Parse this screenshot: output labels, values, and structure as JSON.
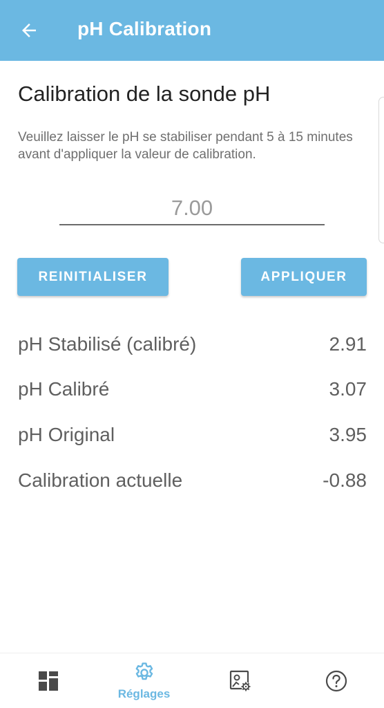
{
  "header": {
    "title": "pH Calibration",
    "back_icon": "arrow-left-icon",
    "background_color": "#6bb8e2"
  },
  "main": {
    "heading": "Calibration de la sonde pH",
    "description": "Veuillez laisser le pH se stabiliser pendant 5 à 15 minutes avant d'appliquer la valeur de calibration.",
    "ph_input": {
      "placeholder": "7.00",
      "value": ""
    },
    "buttons": {
      "reset_label": "REINITIALISER",
      "apply_label": "APPLIQUER"
    },
    "readings": [
      {
        "label": "pH Stabilisé (calibré)",
        "value": "2.91"
      },
      {
        "label": "pH Calibré",
        "value": "3.07"
      },
      {
        "label": "pH Original",
        "value": "3.95"
      },
      {
        "label": "Calibration actuelle",
        "value": "-0.88"
      }
    ]
  },
  "bottom_nav": {
    "items": [
      {
        "icon": "dashboard-icon",
        "label": "",
        "active": false
      },
      {
        "icon": "gear-icon",
        "label": "Réglages",
        "active": true
      },
      {
        "icon": "image-settings-icon",
        "label": "",
        "active": false
      },
      {
        "icon": "help-circle-icon",
        "label": "",
        "active": false
      }
    ],
    "active_color": "#6bb8e2",
    "inactive_color": "#4a4a4a"
  }
}
